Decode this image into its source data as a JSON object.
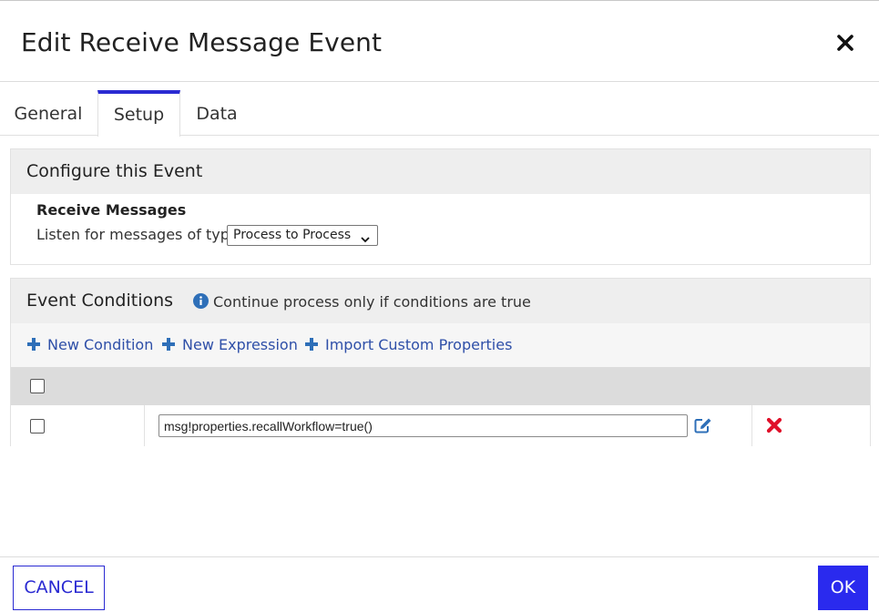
{
  "dialog": {
    "title": "Edit Receive Message Event",
    "close_icon": "close-icon"
  },
  "tabs": [
    {
      "label": "General",
      "active": false
    },
    {
      "label": "Setup",
      "active": true
    },
    {
      "label": "Data",
      "active": false
    }
  ],
  "configure": {
    "heading": "Configure this Event",
    "section_title": "Receive Messages",
    "listen_label": "Listen for messages of type",
    "message_type": "Process to Process"
  },
  "conditions": {
    "heading": "Event Conditions",
    "info_text": "Continue process only if conditions are true",
    "actions": {
      "new_condition": "New Condition",
      "new_expression": "New Expression",
      "import_custom": "Import Custom Properties"
    },
    "rows": [
      {
        "expression": "msg!properties.recallWorkflow=true()",
        "checked": false
      }
    ]
  },
  "footer": {
    "cancel_label": "CANCEL",
    "ok_label": "OK"
  },
  "colors": {
    "accent": "#2a2ad2",
    "link": "#2e4fa8",
    "delete": "#e0102a",
    "header_bg": "#eeeeee"
  }
}
